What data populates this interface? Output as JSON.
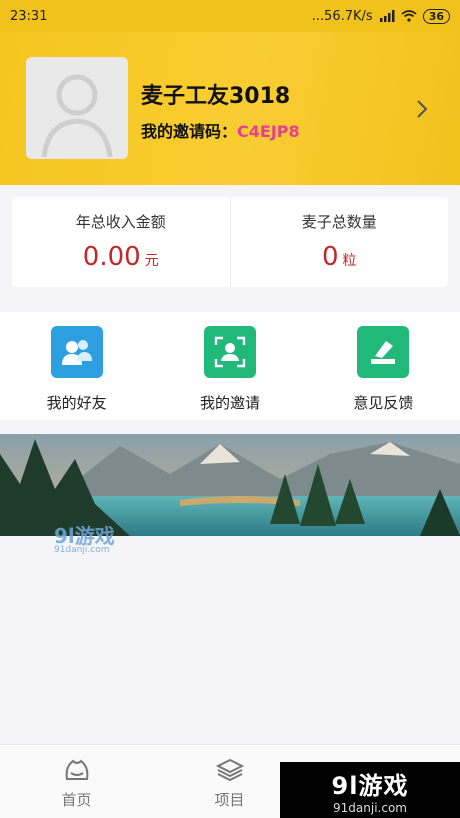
{
  "status_bar": {
    "time": "23:31",
    "network_speed": "...56.7K/s",
    "battery": "36"
  },
  "profile": {
    "username": "麦子工友3018",
    "invite_label": "我的邀请码：",
    "invite_code": "C4EJP8"
  },
  "stats": [
    {
      "label": "年总收入金额",
      "value": "0.00",
      "unit": "元"
    },
    {
      "label": "麦子总数量",
      "value": "0",
      "unit": "粒"
    }
  ],
  "actions": [
    {
      "label": "我的好友",
      "icon": "friends-icon",
      "color": "#2d9ee0"
    },
    {
      "label": "我的邀请",
      "icon": "invite-scan-icon",
      "color": "#20b97a"
    },
    {
      "label": "意见反馈",
      "icon": "feedback-icon",
      "color": "#20b97a"
    }
  ],
  "banner_watermark": {
    "brand": "9l游戏",
    "domain": "91danji.com"
  },
  "tabs": [
    {
      "label": "首页",
      "icon": "home-icon"
    },
    {
      "label": "项目",
      "icon": "layers-icon"
    }
  ],
  "corner_logo": {
    "brand": "9l游戏",
    "domain": "91danji.com"
  },
  "colors": {
    "header_yellow": "#f6c61f",
    "accent_pink": "#e63f8f",
    "value_red": "#c0282a"
  }
}
